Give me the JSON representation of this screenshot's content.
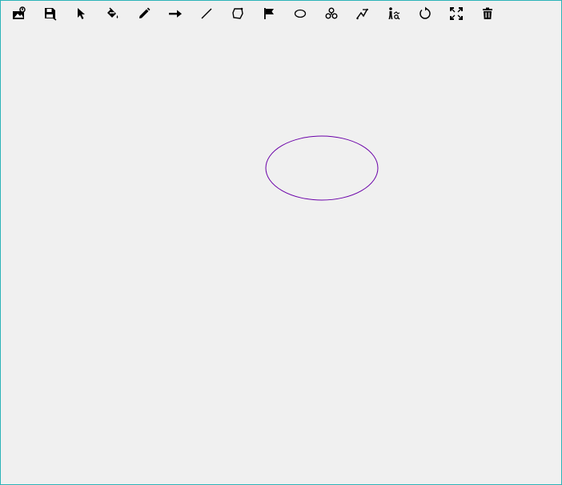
{
  "toolbar": {
    "tools": [
      {
        "id": "image",
        "icon": "image-upload-icon"
      },
      {
        "id": "save",
        "icon": "save-icon"
      },
      {
        "id": "select",
        "icon": "pointer-icon"
      },
      {
        "id": "fill",
        "icon": "paint-bucket-icon"
      },
      {
        "id": "pencil",
        "icon": "pencil-icon"
      },
      {
        "id": "arrow",
        "icon": "arrow-right-icon"
      },
      {
        "id": "line",
        "icon": "line-icon"
      },
      {
        "id": "polygon",
        "icon": "polygon-icon"
      },
      {
        "id": "flag",
        "icon": "flag-icon"
      },
      {
        "id": "ellipse",
        "icon": "ellipse-icon"
      },
      {
        "id": "cluster",
        "icon": "circles-cluster-icon"
      },
      {
        "id": "path",
        "icon": "path-tool-icon"
      },
      {
        "id": "person",
        "icon": "person-tool-icon"
      },
      {
        "id": "undo",
        "icon": "undo-icon"
      },
      {
        "id": "fullscreen",
        "icon": "fullscreen-icon"
      },
      {
        "id": "delete",
        "icon": "trash-icon"
      }
    ]
  },
  "canvas": {
    "background": "#f0f0f0",
    "shapes": [
      {
        "type": "ellipse",
        "stroke": "#6a00a8",
        "fill": "none"
      }
    ]
  },
  "colors": {
    "frame_border": "#2bb3b8",
    "icon": "#000000"
  }
}
